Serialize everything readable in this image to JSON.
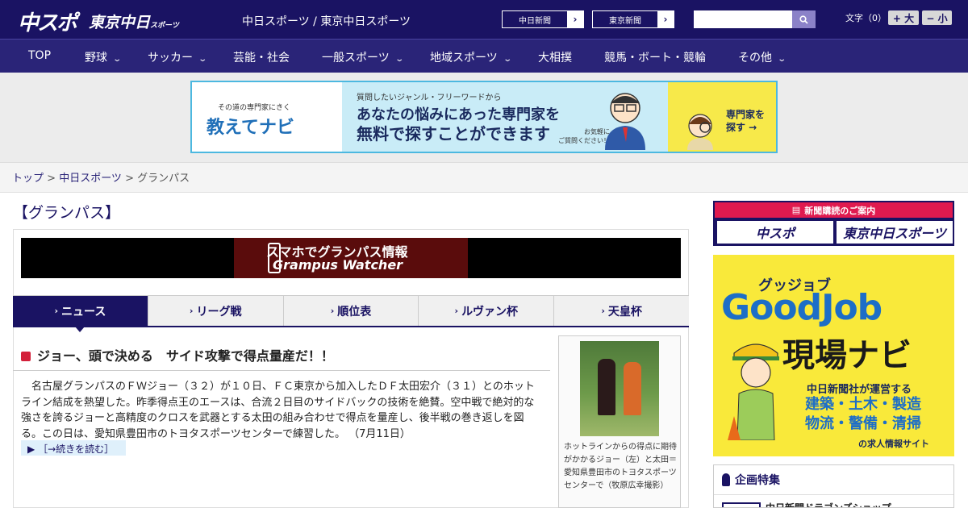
{
  "header": {
    "logo_main": "中スポ",
    "logo_sub": "東京中日",
    "logo_sub_small": "スポーツ",
    "site_title": "中日スポーツ / 東京中日スポーツ",
    "ext_links": [
      "中日新聞",
      "東京新聞"
    ],
    "search_placeholder": "",
    "font_label": "文字（0）",
    "font_bigger": "+ 大",
    "font_smaller": "− 小"
  },
  "nav": {
    "items": [
      {
        "label": "TOP"
      },
      {
        "label": "野球",
        "dropdown": true
      },
      {
        "label": "サッカー",
        "dropdown": true
      },
      {
        "label": "芸能・社会"
      },
      {
        "label": "一般スポーツ",
        "dropdown": true
      },
      {
        "label": "地域スポーツ",
        "dropdown": true
      },
      {
        "label": "大相撲"
      },
      {
        "label": "競馬・ボート・競輪"
      },
      {
        "label": "その他",
        "dropdown": true
      }
    ]
  },
  "ad_banner": {
    "small": "その道の専門家にきく",
    "logo": "教えてナビ",
    "line1": "質問したいジャンル・フリーワードから",
    "line2": "あなたの悩みにあった専門家を",
    "line3": "無料で探すことができます",
    "note": "お気軽に\nご質問ください！",
    "cta": "専門家を\n探す →"
  },
  "breadcrumb": {
    "items": [
      "トップ",
      "中日スポーツ",
      "グランパス"
    ]
  },
  "page": {
    "heading": "【グランパス】",
    "app_banner_line1": "スマホでグランパス情報",
    "app_banner_line2": "Grampus Watcher"
  },
  "tabs": [
    {
      "label": "ニュース",
      "active": true
    },
    {
      "label": "リーグ戦"
    },
    {
      "label": "順位表"
    },
    {
      "label": "ルヴァン杯"
    },
    {
      "label": "天皇杯"
    }
  ],
  "article": {
    "title": "ジョー、頭で決める　サイド攻撃で得点量産だ！！",
    "body": "　名古屋グランパスのＦＷジョー（３２）が１０日、ＦＣ東京から加入したＤＦ太田宏介（３１）とのホットライン結成を熱望した。昨季得点王のエースは、合流２日目のサイドバックの技術を絶賛。空中戦で絶対的な強さを誇るジョーと高精度のクロスを武器とする太田の組み合わせで得点を量産し、後半戦の巻き返しを図る。この日は、愛知県豊田市のトヨタスポーツセンターで練習した。",
    "date": "（7月11日）",
    "more_label": "［→続きを読む］",
    "photo_caption": "ホットラインからの得点に期待がかかるジョー（左）と太田＝愛知県豊田市のトヨタスポーツセンターで（牧原広幸撮影）"
  },
  "sidebar": {
    "subscribe_title": "新聞購読のご案内",
    "subscribe_buttons": [
      "中スポ",
      "東京中日スポーツ"
    ],
    "goodjob": {
      "kana": "グッジョブ",
      "brand": "GoodJob",
      "title": "現場ナビ",
      "sub": "中日新聞社が運営する",
      "jobs1": "建築・土木・製造",
      "jobs2": "物流・警備・清掃",
      "foot": "の求人情報サイト"
    },
    "feature_title": "企画特集",
    "feature_item": "中日新聞ドラゴンズショップ"
  },
  "colors": {
    "header_bg": "#1a1363",
    "nav_bg": "#2a2478",
    "accent_red": "#d3203a",
    "subscribe_red": "#e01a4f",
    "goodjob_yellow": "#f9e93a"
  }
}
